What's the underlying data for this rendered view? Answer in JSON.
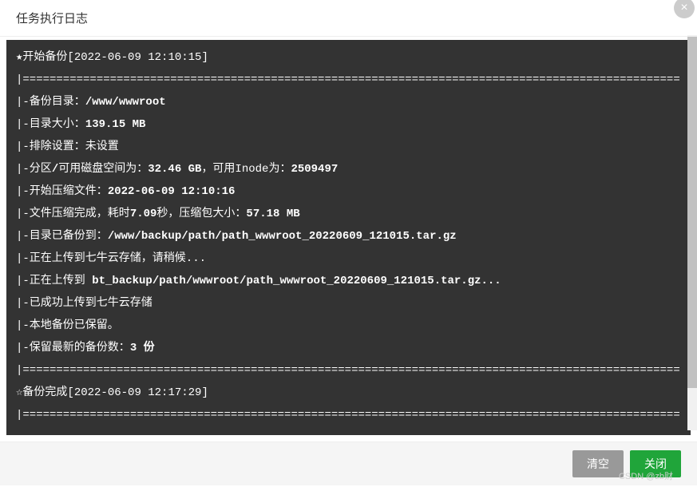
{
  "header": {
    "title": "任务执行日志",
    "close_label": "×"
  },
  "log": {
    "line1": "★开始备份[2022-06-09 12:10:15]",
    "sep1": "|==================================================================================================",
    "line2_prefix": "|-备份目录：",
    "line2_bold": "/www/wwwroot",
    "line3_prefix": "|-目录大小：",
    "line3_bold": "139.15 MB",
    "line4": "|-排除设置：未设置",
    "line5_prefix": "|-分区",
    "line5_bold1": "/",
    "line5_mid": "可用磁盘空间为：",
    "line5_bold2": "32.46 GB",
    "line5_mid2": "，可用Inode为：",
    "line5_bold3": "2509497",
    "line6_prefix": "|-开始压缩文件：",
    "line6_bold": "2022-06-09 12:10:16",
    "line7_prefix": "|-文件压缩完成，耗时",
    "line7_bold1": "7.09",
    "line7_mid": "秒，压缩包大小：",
    "line7_bold2": "57.18 MB",
    "line8_prefix": "|-目录已备份到：",
    "line8_bold": "/www/backup/path/path_wwwroot_20220609_121015.tar.gz",
    "line9": "|-正在上传到七牛云存储，请稍候...",
    "line10_prefix": "|-正在上传到 ",
    "line10_bold": "bt_backup/path/wwwroot/path_wwwroot_20220609_121015.tar.gz...",
    "line11": "|-已成功上传到七牛云存储",
    "line12": "|-本地备份已保留。",
    "line13_prefix": "|-保留最新的备份数：",
    "line13_bold": "3 份",
    "sep2": "|==================================================================================================",
    "line14": "☆备份完成[2022-06-09 12:17:29]",
    "sep3": "|=================================================================================================="
  },
  "footer": {
    "clear_label": "清空",
    "close_label": "关闭"
  },
  "watermark": "CSDN @zb财"
}
